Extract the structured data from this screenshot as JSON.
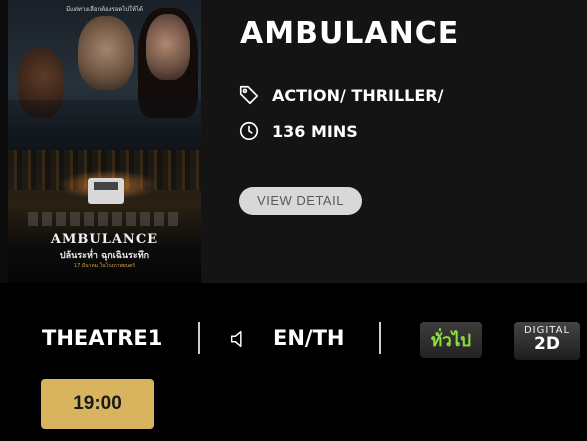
{
  "movie": {
    "title": "AMBULANCE",
    "genre": "ACTION/ THRILLER/",
    "duration": "136 MINS",
    "detail_button": "VIEW DETAIL",
    "genre_icon": "tag-icon",
    "duration_icon": "clock-icon"
  },
  "poster": {
    "tagline": "มีแต่ทางเลือกต้องรอดไปให้ได้",
    "title": "AMBULANCE",
    "subtitle": "ปล้นระห่ำ ฉุกเฉินระทึก",
    "date_text": "17 มีนาคม ในโรงภาพยนตร์"
  },
  "showing": {
    "theatre": "THEATRE1",
    "audio_icon": "speaker-icon",
    "language": "EN/TH",
    "rating_badge": "ทั่วไป",
    "format_line1": "DIGITAL",
    "format_line2": "2D",
    "times": [
      "19:00"
    ]
  },
  "colors": {
    "background": "#000000",
    "panel": "#141414",
    "showtime_button": "#d9b45e",
    "rating_text": "#8fe03c"
  }
}
